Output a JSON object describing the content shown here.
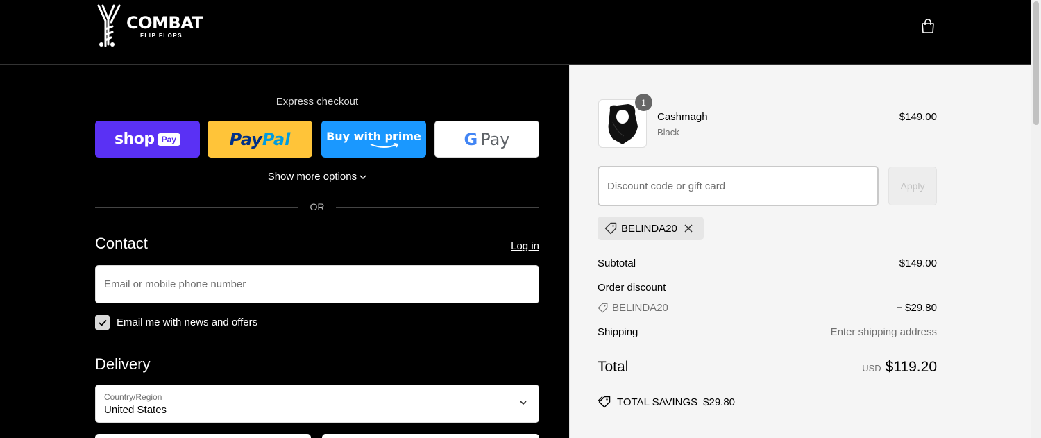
{
  "header": {
    "brand_title": "COMBAT",
    "brand_sub": "FLIP FLOPS"
  },
  "express": {
    "label": "Express checkout",
    "shop_pay": {
      "word": "shop",
      "chip": "Pay"
    },
    "paypal": {
      "part1": "Pay",
      "part2": "Pal"
    },
    "prime": {
      "label": "Buy with prime"
    },
    "gpay": {
      "g": "G",
      "pay": "Pay"
    },
    "more_options": "Show more options",
    "divider": "OR"
  },
  "contact": {
    "title": "Contact",
    "login": "Log in",
    "email_placeholder": "Email or mobile phone number",
    "newsletter_label": "Email me with news and offers",
    "newsletter_checked": true
  },
  "delivery": {
    "title": "Delivery",
    "country_label": "Country/Region",
    "country_value": "United States"
  },
  "summary": {
    "product": {
      "name": "Cashmagh",
      "variant": "Black",
      "price": "$149.00",
      "quantity": "1"
    },
    "discount_placeholder": "Discount code or gift card",
    "apply_label": "Apply",
    "applied_code": "BELINDA20",
    "subtotal_label": "Subtotal",
    "subtotal_value": "$149.00",
    "order_discount_label": "Order discount",
    "discount_code": "BELINDA20",
    "discount_value": "− $29.80",
    "shipping_label": "Shipping",
    "shipping_value": "Enter shipping address",
    "total_label": "Total",
    "total_currency": "USD",
    "total_value": "$119.20",
    "savings_label": "TOTAL SAVINGS",
    "savings_value": "$29.80"
  },
  "colors": {
    "shop_pay": "#5a31f4",
    "paypal": "#ffc439",
    "prime": "#1a98ff",
    "left_bg": "#000000",
    "right_bg": "#f5f5f5"
  }
}
